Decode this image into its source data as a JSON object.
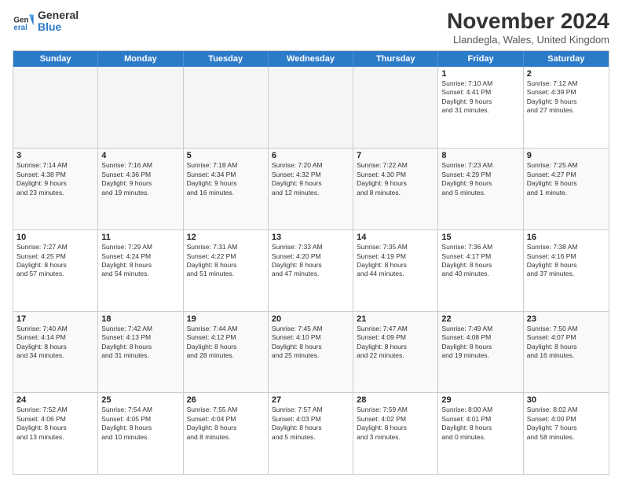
{
  "logo": {
    "general": "General",
    "blue": "Blue"
  },
  "title": "November 2024",
  "location": "Llandegla, Wales, United Kingdom",
  "days_of_week": [
    "Sunday",
    "Monday",
    "Tuesday",
    "Wednesday",
    "Thursday",
    "Friday",
    "Saturday"
  ],
  "weeks": [
    [
      {
        "day": "",
        "info": ""
      },
      {
        "day": "",
        "info": ""
      },
      {
        "day": "",
        "info": ""
      },
      {
        "day": "",
        "info": ""
      },
      {
        "day": "",
        "info": ""
      },
      {
        "day": "1",
        "info": "Sunrise: 7:10 AM\nSunset: 4:41 PM\nDaylight: 9 hours\nand 31 minutes."
      },
      {
        "day": "2",
        "info": "Sunrise: 7:12 AM\nSunset: 4:39 PM\nDaylight: 9 hours\nand 27 minutes."
      }
    ],
    [
      {
        "day": "3",
        "info": "Sunrise: 7:14 AM\nSunset: 4:38 PM\nDaylight: 9 hours\nand 23 minutes."
      },
      {
        "day": "4",
        "info": "Sunrise: 7:16 AM\nSunset: 4:36 PM\nDaylight: 9 hours\nand 19 minutes."
      },
      {
        "day": "5",
        "info": "Sunrise: 7:18 AM\nSunset: 4:34 PM\nDaylight: 9 hours\nand 16 minutes."
      },
      {
        "day": "6",
        "info": "Sunrise: 7:20 AM\nSunset: 4:32 PM\nDaylight: 9 hours\nand 12 minutes."
      },
      {
        "day": "7",
        "info": "Sunrise: 7:22 AM\nSunset: 4:30 PM\nDaylight: 9 hours\nand 8 minutes."
      },
      {
        "day": "8",
        "info": "Sunrise: 7:23 AM\nSunset: 4:29 PM\nDaylight: 9 hours\nand 5 minutes."
      },
      {
        "day": "9",
        "info": "Sunrise: 7:25 AM\nSunset: 4:27 PM\nDaylight: 9 hours\nand 1 minute."
      }
    ],
    [
      {
        "day": "10",
        "info": "Sunrise: 7:27 AM\nSunset: 4:25 PM\nDaylight: 8 hours\nand 57 minutes."
      },
      {
        "day": "11",
        "info": "Sunrise: 7:29 AM\nSunset: 4:24 PM\nDaylight: 8 hours\nand 54 minutes."
      },
      {
        "day": "12",
        "info": "Sunrise: 7:31 AM\nSunset: 4:22 PM\nDaylight: 8 hours\nand 51 minutes."
      },
      {
        "day": "13",
        "info": "Sunrise: 7:33 AM\nSunset: 4:20 PM\nDaylight: 8 hours\nand 47 minutes."
      },
      {
        "day": "14",
        "info": "Sunrise: 7:35 AM\nSunset: 4:19 PM\nDaylight: 8 hours\nand 44 minutes."
      },
      {
        "day": "15",
        "info": "Sunrise: 7:36 AM\nSunset: 4:17 PM\nDaylight: 8 hours\nand 40 minutes."
      },
      {
        "day": "16",
        "info": "Sunrise: 7:38 AM\nSunset: 4:16 PM\nDaylight: 8 hours\nand 37 minutes."
      }
    ],
    [
      {
        "day": "17",
        "info": "Sunrise: 7:40 AM\nSunset: 4:14 PM\nDaylight: 8 hours\nand 34 minutes."
      },
      {
        "day": "18",
        "info": "Sunrise: 7:42 AM\nSunset: 4:13 PM\nDaylight: 8 hours\nand 31 minutes."
      },
      {
        "day": "19",
        "info": "Sunrise: 7:44 AM\nSunset: 4:12 PM\nDaylight: 8 hours\nand 28 minutes."
      },
      {
        "day": "20",
        "info": "Sunrise: 7:45 AM\nSunset: 4:10 PM\nDaylight: 8 hours\nand 25 minutes."
      },
      {
        "day": "21",
        "info": "Sunrise: 7:47 AM\nSunset: 4:09 PM\nDaylight: 8 hours\nand 22 minutes."
      },
      {
        "day": "22",
        "info": "Sunrise: 7:49 AM\nSunset: 4:08 PM\nDaylight: 8 hours\nand 19 minutes."
      },
      {
        "day": "23",
        "info": "Sunrise: 7:50 AM\nSunset: 4:07 PM\nDaylight: 8 hours\nand 16 minutes."
      }
    ],
    [
      {
        "day": "24",
        "info": "Sunrise: 7:52 AM\nSunset: 4:06 PM\nDaylight: 8 hours\nand 13 minutes."
      },
      {
        "day": "25",
        "info": "Sunrise: 7:54 AM\nSunset: 4:05 PM\nDaylight: 8 hours\nand 10 minutes."
      },
      {
        "day": "26",
        "info": "Sunrise: 7:55 AM\nSunset: 4:04 PM\nDaylight: 8 hours\nand 8 minutes."
      },
      {
        "day": "27",
        "info": "Sunrise: 7:57 AM\nSunset: 4:03 PM\nDaylight: 8 hours\nand 5 minutes."
      },
      {
        "day": "28",
        "info": "Sunrise: 7:59 AM\nSunset: 4:02 PM\nDaylight: 8 hours\nand 3 minutes."
      },
      {
        "day": "29",
        "info": "Sunrise: 8:00 AM\nSunset: 4:01 PM\nDaylight: 8 hours\nand 0 minutes."
      },
      {
        "day": "30",
        "info": "Sunrise: 8:02 AM\nSunset: 4:00 PM\nDaylight: 7 hours\nand 58 minutes."
      }
    ]
  ]
}
